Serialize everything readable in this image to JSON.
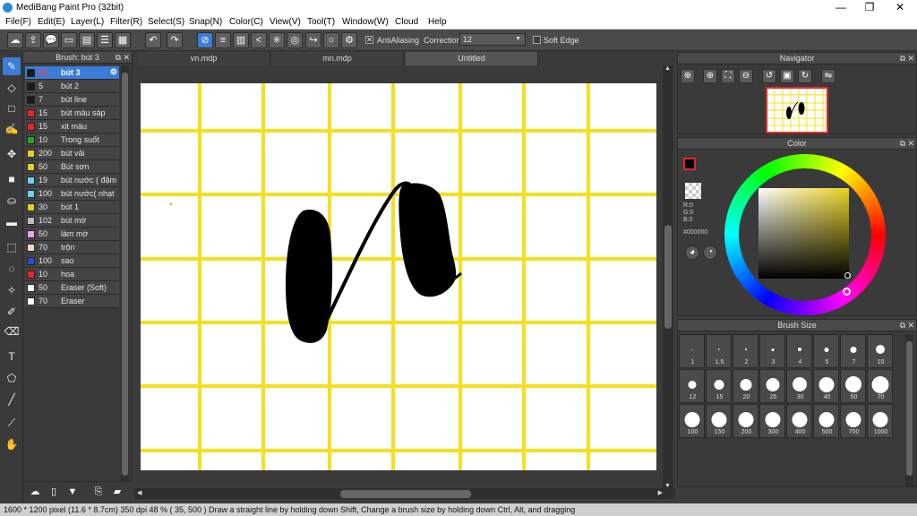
{
  "window": {
    "title": "MediBang Paint Pro (32bit)",
    "minimize": "—",
    "maximize": "❐",
    "close": "✕"
  },
  "menu": [
    "File(F)",
    "Edit(E)",
    "Layer(L)",
    "Filter(R)",
    "Select(S)",
    "Snap(N)",
    "Color(C)",
    "View(V)",
    "Tool(T)",
    "Window(W)",
    "Cloud",
    "Help"
  ],
  "toolbar": {
    "antialiasing_label": "AntiAliasing",
    "antialiasing_checked": "✕",
    "correction_label": "Correction",
    "correction_value": "12",
    "soft_edge_label": "Soft Edge"
  },
  "brush_panel": {
    "title": "Brush: bút 3",
    "items": [
      {
        "size": "20",
        "name": "bút 3",
        "color": "#1a1a1a"
      },
      {
        "size": "5",
        "name": "bút 2",
        "color": "#1a1a1a"
      },
      {
        "size": "7",
        "name": "bút line",
        "color": "#1a1a1a"
      },
      {
        "size": "15",
        "name": "bút màu sáp",
        "color": "#e02a2a"
      },
      {
        "size": "15",
        "name": "xịt màu",
        "color": "#e02a2a"
      },
      {
        "size": "10",
        "name": "Trong suốt",
        "color": "#2aa02a"
      },
      {
        "size": "200",
        "name": "bút vải",
        "color": "#e8d21e"
      },
      {
        "size": "50",
        "name": "Bút sơn",
        "color": "#e8d21e"
      },
      {
        "size": "19",
        "name": "bút nước ( đậm",
        "color": "#6fd0f0"
      },
      {
        "size": "100",
        "name": "bút nước( nhạt",
        "color": "#6fd0f0"
      },
      {
        "size": "30",
        "name": "bút 1",
        "color": "#e8d21e"
      },
      {
        "size": "102",
        "name": "bút mờ",
        "color": "#bdbdbd"
      },
      {
        "size": "50",
        "name": "làm mờ",
        "color": "#f0a0f0"
      },
      {
        "size": "70",
        "name": "trộn",
        "color": "#f2d8c8"
      },
      {
        "size": "100",
        "name": "sao",
        "color": "#2a4ad8"
      },
      {
        "size": "10",
        "name": "hoa",
        "color": "#e02a2a"
      },
      {
        "size": "50",
        "name": "Eraser (Soft)",
        "color": "#ffffff"
      },
      {
        "size": "70",
        "name": "Eraser",
        "color": "#ffffff"
      }
    ]
  },
  "tabs": [
    {
      "label": "vn.mdp"
    },
    {
      "label": "mn.mdp"
    },
    {
      "label": "Untitled"
    }
  ],
  "navigator": {
    "title": "Navigator"
  },
  "color_panel": {
    "title": "Color",
    "r": "R:0",
    "g": "G:0",
    "b": "B:0",
    "hex": "#000000"
  },
  "brush_size": {
    "title": "Brush Size",
    "sizes": [
      "1",
      "1.5",
      "2",
      "3",
      "4",
      "5",
      "7",
      "10",
      "12",
      "15",
      "20",
      "25",
      "30",
      "40",
      "50",
      "70",
      "100",
      "150",
      "200",
      "300",
      "400",
      "500",
      "700",
      "1000"
    ]
  },
  "status": "1600 * 1200 pixel   (11.6 * 8.7cm)  350 dpi  48 %   ( 35, 500 )  Draw a straight line by holding down Shift, Change a brush size by holding down Ctrl, Alt, and dragging"
}
